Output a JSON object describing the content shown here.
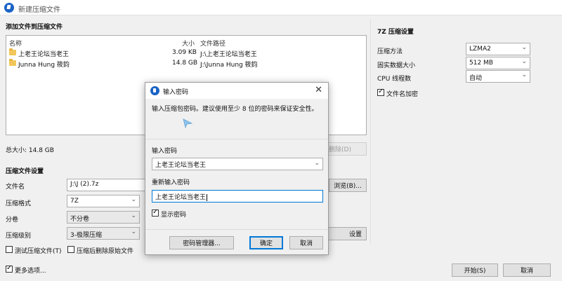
{
  "window": {
    "title": "新建压缩文件"
  },
  "add_section": {
    "title": "添加文件到压缩文件",
    "columns": {
      "name": "名称",
      "size": "大小",
      "path": "文件路径"
    },
    "files": [
      {
        "name": "上老王论坛当老王",
        "size": "3.09 KB",
        "path": "J:\\上老王论坛当老王"
      },
      {
        "name": "Junna Hung 筱鈞",
        "size": "14.8 GB",
        "path": "J:\\Junna Hung 筱鈞"
      }
    ],
    "total_size": "总大小: 14.8 GB",
    "delete_label": "删除(D)"
  },
  "archive_settings": {
    "title": "压缩文件设置",
    "filename_label": "文件名",
    "filename_value": "J:\\J (2).7z",
    "browse_label": "浏览(B)...",
    "format_label": "压缩格式",
    "format_value": "7Z",
    "split_label": "分卷",
    "split_value": "不分卷",
    "level_label": "压缩级别",
    "level_value": "3-极限压缩",
    "settings_label": "设置",
    "test_label": "测试压缩文件(T)",
    "delete_source_label": "压缩后删除原始文件"
  },
  "seven_z": {
    "title": "7Z 压缩设置",
    "method_label": "压缩方法",
    "method_value": "LZMA2",
    "dict_label": "固实数据大小",
    "dict_value": "512 MB",
    "threads_label": "CPU 线程数",
    "threads_value": "自动",
    "encrypt_names_label": "文件名加密"
  },
  "footer": {
    "more_options": "更多选项...",
    "start": "开始(S)",
    "cancel": "取消"
  },
  "dialog": {
    "title": "输入密码",
    "hint": "输入压缩包密码。建议使用至少 8 位的密码来保证安全性。",
    "password_label": "输入密码",
    "password_value": "上老王论坛当老王",
    "confirm_label": "重新输入密码",
    "confirm_value": "上老王论坛当老王",
    "show_password": "显示密码",
    "manager_button": "密码管理器...",
    "ok_button": "确定",
    "cancel_button": "取消"
  }
}
